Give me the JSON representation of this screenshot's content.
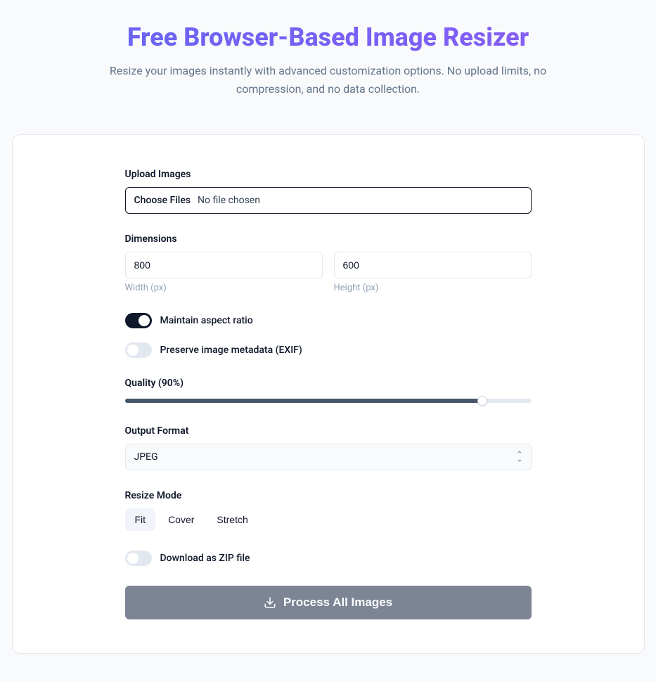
{
  "header": {
    "title": "Free Browser-Based Image Resizer",
    "subtitle": "Resize your images instantly with advanced customization options. No upload limits, no compression, and no data collection."
  },
  "upload": {
    "label": "Upload Images",
    "button": "Choose Files",
    "placeholder": "No file chosen"
  },
  "dimensions": {
    "label": "Dimensions",
    "width_value": "800",
    "width_label": "Width (px)",
    "height_value": "600",
    "height_label": "Height (px)"
  },
  "toggles": {
    "aspect_ratio": "Maintain aspect ratio",
    "preserve_exif": "Preserve image metadata (EXIF)",
    "download_zip": "Download as ZIP file"
  },
  "quality": {
    "label": "Quality (90%)",
    "value": 90
  },
  "output_format": {
    "label": "Output Format",
    "value": "JPEG"
  },
  "resize_mode": {
    "label": "Resize Mode",
    "options": [
      "Fit",
      "Cover",
      "Stretch"
    ],
    "selected": "Fit"
  },
  "process_button": "Process All Images"
}
